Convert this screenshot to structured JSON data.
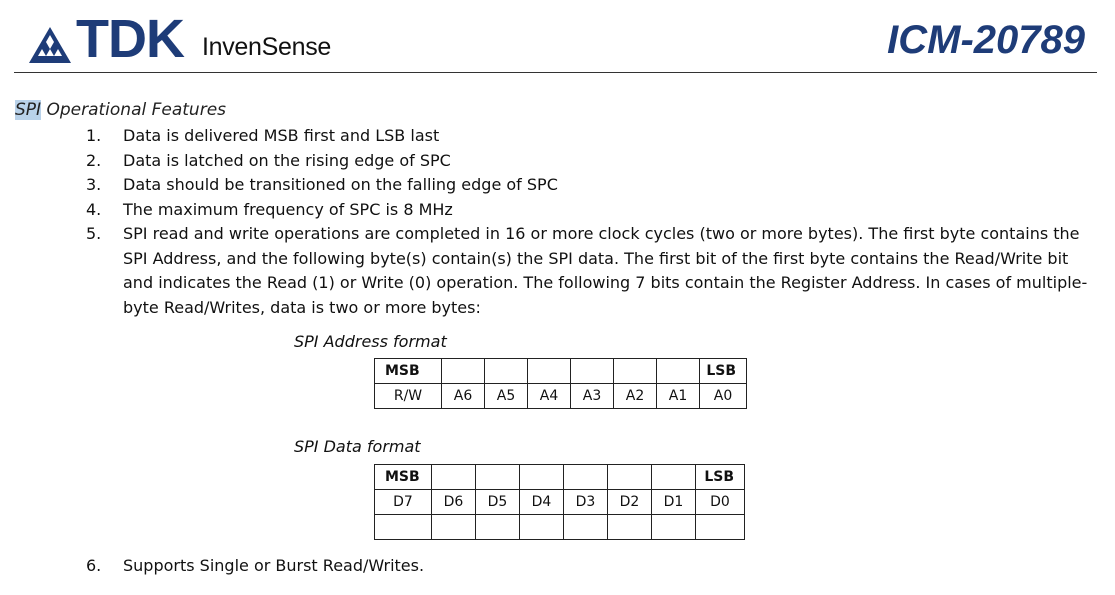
{
  "header": {
    "brand": "TDK",
    "sub_brand": "InvenSense",
    "part_number": "ICM-20789",
    "brand_color": "#1e3c78"
  },
  "section": {
    "title_highlight": "SPI",
    "title_rest": " Operational Features"
  },
  "features": [
    {
      "num": "1.",
      "text": "Data is delivered MSB first and LSB last"
    },
    {
      "num": "2.",
      "text": "Data is latched on the rising edge of SPC"
    },
    {
      "num": "3.",
      "text": "Data should be transitioned on the falling edge of SPC"
    },
    {
      "num": "4.",
      "text": "The maximum frequency of SPC is 8 MHz"
    },
    {
      "num": "5.",
      "text": "SPI read and write operations are completed in 16 or more clock cycles (two or more bytes). The first byte contains the SPI Address, and the following byte(s) contain(s) the SPI data. The first bit of the first byte contains the Read/Write bit and indicates the Read (1) or Write (0) operation. The following 7 bits contain the Register Address. In cases of multiple-byte Read/Writes, data is two or more bytes:"
    }
  ],
  "address_format": {
    "title": "SPI Address format",
    "msb": "MSB",
    "lsb": "LSB",
    "bits": [
      "R/W",
      "A6",
      "A5",
      "A4",
      "A3",
      "A2",
      "A1",
      "A0"
    ]
  },
  "data_format": {
    "title": "SPI Data format",
    "msb": "MSB",
    "lsb": "LSB",
    "bits": [
      "D7",
      "D6",
      "D5",
      "D4",
      "D3",
      "D2",
      "D1",
      "D0"
    ]
  },
  "feature6": {
    "num": "6.",
    "text": "Supports Single or Burst Read/Writes."
  }
}
